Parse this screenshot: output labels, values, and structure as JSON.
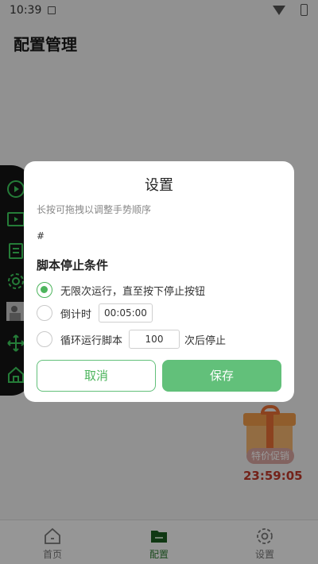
{
  "status": {
    "time": "10:39"
  },
  "page": {
    "title": "配置管理"
  },
  "dialog": {
    "title": "设置",
    "hint": "长按可拖拽以调整手势顺序",
    "hash": "#",
    "section_title": "脚本停止条件",
    "options": [
      {
        "label": "无限次运行，直至按下停止按钮",
        "checked": true
      },
      {
        "label": "倒计时",
        "input_value": "00:05:00",
        "checked": false
      },
      {
        "label": "循环运行脚本",
        "input_value": "100",
        "suffix": "次后停止",
        "checked": false
      }
    ],
    "cancel_label": "取消",
    "save_label": "保存"
  },
  "promo": {
    "tag": "特价促销",
    "timer": "23:59:05"
  },
  "nav": [
    {
      "label": "首页",
      "icon": "home-icon"
    },
    {
      "label": "配置",
      "icon": "folder-icon",
      "active": true
    },
    {
      "label": "设置",
      "icon": "gear-icon"
    }
  ],
  "colors": {
    "accent": "#62c07a",
    "accent_dark": "#2e7d32",
    "timer": "#c0392b"
  }
}
